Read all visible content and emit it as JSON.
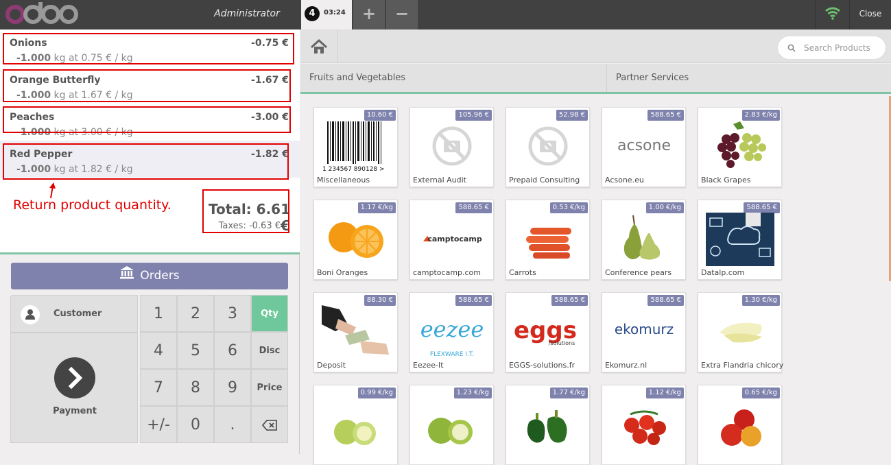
{
  "topbar": {
    "brand": "odoo",
    "user": "Administrator",
    "order_number": "4",
    "order_time": "03:24",
    "add_label": "+",
    "remove_label": "−",
    "close_label": "Close"
  },
  "orderlines": [
    {
      "name": "Onions",
      "price": "-0.75 €",
      "qty": "-1.000",
      "info": " kg at 0.75 € / kg"
    },
    {
      "name": "Orange Butterfly",
      "price": "-1.67 €",
      "qty": "-1.000",
      "info": " kg at 1.67 € / kg"
    },
    {
      "name": "Peaches",
      "price": "-3.00 €",
      "qty": "-1.000",
      "info": " kg at 3.00 € / kg"
    },
    {
      "name": "Red Pepper",
      "price": "-1.82 €",
      "qty": "-1.000",
      "info": " kg at 1.82 € / kg"
    }
  ],
  "annotation": "Return product quantity.",
  "summary": {
    "total": "Total: 6.61 €",
    "taxes": "Taxes: -0.63 €"
  },
  "orders_button": "Orders",
  "customer_label": "Customer",
  "payment_label": "Payment",
  "numpad": {
    "digits": [
      "1",
      "2",
      "3",
      "4",
      "5",
      "6",
      "7",
      "8",
      "9",
      "+/-",
      "0",
      "."
    ],
    "modes": [
      "Qty",
      "Disc",
      "Price"
    ]
  },
  "search": {
    "placeholder": "Search Products"
  },
  "categories": [
    "Fruits and Vegetables",
    "Partner Services"
  ],
  "products": [
    {
      "name": "Miscellaneous",
      "price": "10.60 €"
    },
    {
      "name": "External Audit",
      "price": "105.96 €"
    },
    {
      "name": "Prepaid Consulting",
      "price": "52.98 €"
    },
    {
      "name": "Acsone.eu",
      "price": "588.65 €"
    },
    {
      "name": "Black Grapes",
      "price": "2.83 €/kg"
    },
    {
      "name": "Boni Oranges",
      "price": "1.17 €/kg"
    },
    {
      "name": "camptocamp.com",
      "price": "588.65 €"
    },
    {
      "name": "Carrots",
      "price": "0.53 €/kg"
    },
    {
      "name": "Conference pears",
      "price": "1.00 €/kg"
    },
    {
      "name": "Datalp.com",
      "price": "588.65 €"
    },
    {
      "name": "Deposit",
      "price": "88.30 €"
    },
    {
      "name": "Eezee-It",
      "price": "588.65 €"
    },
    {
      "name": "EGGS-solutions.fr",
      "price": "588.65 €"
    },
    {
      "name": "Ekomurz.nl",
      "price": "588.65 €"
    },
    {
      "name": "Extra Flandria chicory",
      "price": "1.30 €/kg"
    },
    {
      "name": "",
      "price": "0.99 €/kg"
    },
    {
      "name": "",
      "price": "1.23 €/kg"
    },
    {
      "name": "",
      "price": "1.77 €/kg"
    },
    {
      "name": "",
      "price": "1.12 €/kg"
    },
    {
      "name": "",
      "price": "0.65 €/kg"
    }
  ],
  "image_text": {
    "barcode": "1 234567 890128 >",
    "acsone": "acsone",
    "camptocamp": "camptocamp",
    "eezee": "eezee",
    "eezee_sub": "FLEXWARE I.T.",
    "eggs": "eggs",
    "eggs_sub": "/solutions",
    "ekomurz": "ekomurz"
  },
  "colors": {
    "accent": "#7f82ac",
    "green": "#6ec89b",
    "annotation": "#e00000"
  }
}
